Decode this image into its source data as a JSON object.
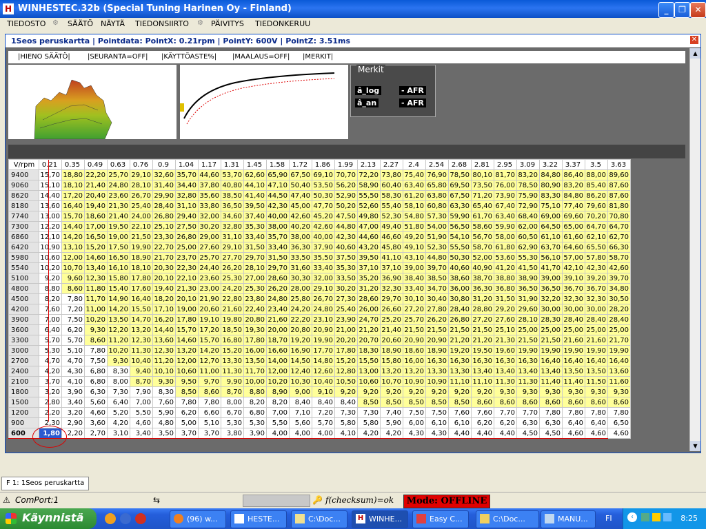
{
  "window": {
    "title": "WINHESTEC.32b (Special Tuning Harinen Oy - Finland)"
  },
  "menu": [
    "TIEDOSTO",
    "SÄÄTÖ",
    "NÄYTÄ",
    "TIEDONSIIRTO",
    "PÄIVITYS",
    "TIEDONKERUU"
  ],
  "child": {
    "title": "1Seos peruskartta | Pointdata: PointX: 0.21rpm | PointY: 600V | PointZ: 3.51ms",
    "toolbar": [
      "|HIENO SÄÄTÖ|",
      "|SEURANTA=OFF|",
      "|KÄYTTÖASTE%|",
      "|MAALAUS=OFF|",
      "|MERKIT|"
    ],
    "merkit": {
      "title": "Merkit",
      "tags": [
        [
          "â_log",
          "- AFR"
        ],
        [
          "â_an",
          "- AFR"
        ]
      ]
    }
  },
  "grid": {
    "corner": "V/rpm",
    "cols": [
      "0.21",
      "0.35",
      "0.49",
      "0.63",
      "0.76",
      "0.9",
      "1.04",
      "1.17",
      "1.31",
      "1.45",
      "1.58",
      "1.72",
      "1.86",
      "1.99",
      "2.13",
      "2.27",
      "2.4",
      "2.54",
      "2.68",
      "2.81",
      "2.95",
      "3.09",
      "3.22",
      "3.37",
      "3.5",
      "3.63"
    ],
    "rows": [
      [
        "9400",
        [
          "15,70",
          "18,80",
          "22,20",
          "25,70",
          "29,10",
          "32,60",
          "35,70",
          "44,60",
          "53,70",
          "62,60",
          "65,90",
          "67,50",
          "69,10",
          "70,70",
          "72,20",
          "73,80",
          "75,40",
          "76,90",
          "78,50",
          "80,10",
          "81,70",
          "83,20",
          "84,80",
          "86,40",
          "88,00",
          "89,60"
        ]
      ],
      [
        "9060",
        [
          "15,10",
          "18,10",
          "21,40",
          "24,80",
          "28,10",
          "31,40",
          "34,40",
          "37,80",
          "40,80",
          "44,10",
          "47,10",
          "50,40",
          "53,50",
          "56,20",
          "58,90",
          "60,40",
          "63,40",
          "65,80",
          "69,50",
          "73,50",
          "76,00",
          "78,50",
          "80,90",
          "83,20",
          "85,40",
          "87,60"
        ]
      ],
      [
        "8620",
        [
          "14,40",
          "17,20",
          "20,40",
          "23,60",
          "26,70",
          "29,90",
          "32,80",
          "35,60",
          "38,50",
          "41,40",
          "44,50",
          "47,40",
          "50,30",
          "52,90",
          "55,50",
          "58,30",
          "61,20",
          "63,80",
          "67,50",
          "71,20",
          "73,90",
          "75,90",
          "83,30",
          "84,80",
          "86,20",
          "87,60"
        ]
      ],
      [
        "8180",
        [
          "13,60",
          "16,40",
          "19,40",
          "21,30",
          "25,40",
          "28,40",
          "31,10",
          "33,80",
          "36,50",
          "39,50",
          "42,30",
          "45,00",
          "47,70",
          "50,20",
          "52,60",
          "55,40",
          "58,10",
          "60,80",
          "63,30",
          "65,40",
          "67,40",
          "72,90",
          "75,10",
          "77,40",
          "79,60",
          "81,80"
        ]
      ],
      [
        "7740",
        [
          "13,00",
          "15,70",
          "18,60",
          "21,40",
          "24,00",
          "26,80",
          "29,40",
          "32,00",
          "34,60",
          "37,40",
          "40,00",
          "42,60",
          "45,20",
          "47,50",
          "49,80",
          "52,30",
          "54,80",
          "57,30",
          "59,90",
          "61,70",
          "63,40",
          "68,40",
          "69,00",
          "69,60",
          "70,20",
          "70,80"
        ]
      ],
      [
        "7300",
        [
          "12,20",
          "14,40",
          "17,00",
          "19,50",
          "22,10",
          "25,10",
          "27,50",
          "30,20",
          "32,80",
          "35,30",
          "38,00",
          "40,20",
          "42,60",
          "44,80",
          "47,00",
          "49,40",
          "51,80",
          "54,00",
          "56,50",
          "58,60",
          "59,90",
          "62,00",
          "64,50",
          "65,00",
          "64,70",
          "64,70"
        ]
      ],
      [
        "6860",
        [
          "12,10",
          "14,20",
          "16,50",
          "19,00",
          "21,50",
          "23,30",
          "26,80",
          "29,00",
          "31,10",
          "33,40",
          "35,70",
          "38,00",
          "40,00",
          "42,30",
          "44,60",
          "46,60",
          "49,20",
          "51,90",
          "54,10",
          "56,70",
          "58,00",
          "60,50",
          "61,10",
          "61,60",
          "62,10",
          "62,70"
        ]
      ],
      [
        "6420",
        [
          "10,90",
          "13,10",
          "15,20",
          "17,50",
          "19,90",
          "22,70",
          "25,00",
          "27,60",
          "29,10",
          "31,50",
          "33,40",
          "36,30",
          "37,90",
          "40,60",
          "43,20",
          "45,80",
          "49,10",
          "52,30",
          "55,50",
          "58,70",
          "61,80",
          "62,90",
          "63,70",
          "64,60",
          "65,50",
          "66,30"
        ]
      ],
      [
        "5980",
        [
          "10,60",
          "12,00",
          "14,60",
          "16,50",
          "18,90",
          "21,70",
          "23,70",
          "25,70",
          "27,70",
          "29,70",
          "31,50",
          "33,50",
          "35,50",
          "37,50",
          "39,50",
          "41,10",
          "43,10",
          "44,80",
          "50,30",
          "52,00",
          "53,60",
          "55,30",
          "56,10",
          "57,00",
          "57,80",
          "58,70"
        ]
      ],
      [
        "5540",
        [
          "10,20",
          "10,70",
          "13,40",
          "16,10",
          "18,10",
          "20,30",
          "22,30",
          "24,40",
          "26,20",
          "28,10",
          "29,70",
          "31,60",
          "33,40",
          "35,30",
          "37,10",
          "37,10",
          "39,00",
          "39,70",
          "40,60",
          "40,90",
          "41,20",
          "41,50",
          "41,70",
          "42,10",
          "42,30",
          "42,60"
        ]
      ],
      [
        "5100",
        [
          "9,20",
          "9,60",
          "12,30",
          "15,80",
          "17,80",
          "20,10",
          "22,10",
          "23,60",
          "25,30",
          "27,00",
          "28,60",
          "30,30",
          "32,00",
          "33,50",
          "35,20",
          "36,90",
          "38,40",
          "38,50",
          "38,60",
          "38,70",
          "38,80",
          "38,90",
          "39,00",
          "39,10",
          "39,20",
          "39,70"
        ]
      ],
      [
        "4800",
        [
          "8,80",
          "8,60",
          "11,80",
          "15,40",
          "17,60",
          "19,40",
          "21,30",
          "23,00",
          "24,20",
          "25,30",
          "26,20",
          "28,00",
          "29,10",
          "30,20",
          "31,20",
          "32,30",
          "33,40",
          "34,70",
          "36,00",
          "36,30",
          "36,80",
          "36,50",
          "36,50",
          "36,70",
          "36,70",
          "34,80"
        ]
      ],
      [
        "4500",
        [
          "8,20",
          "7,80",
          "11,70",
          "14,90",
          "16,40",
          "18,20",
          "20,10",
          "21,90",
          "22,80",
          "23,80",
          "24,80",
          "25,80",
          "26,70",
          "27,30",
          "28,60",
          "29,70",
          "30,10",
          "30,40",
          "30,80",
          "31,20",
          "31,50",
          "31,90",
          "32,20",
          "32,30",
          "32,30",
          "30,50"
        ]
      ],
      [
        "4200",
        [
          "7,60",
          "7,20",
          "11,00",
          "14,20",
          "15,50",
          "17,10",
          "19,00",
          "20,60",
          "21,60",
          "22,40",
          "23,40",
          "24,20",
          "24,80",
          "25,40",
          "26,00",
          "26,60",
          "27,20",
          "27,80",
          "28,40",
          "28,80",
          "29,20",
          "29,60",
          "30,00",
          "30,00",
          "30,00",
          "28,20"
        ]
      ],
      [
        "3900",
        [
          "7,00",
          "7,50",
          "10,20",
          "13,50",
          "14,70",
          "16,20",
          "17,80",
          "19,10",
          "19,80",
          "20,80",
          "21,60",
          "22,20",
          "23,10",
          "23,90",
          "24,70",
          "25,20",
          "25,70",
          "26,20",
          "26,80",
          "27,20",
          "27,60",
          "28,10",
          "28,30",
          "28,40",
          "28,40",
          "28,40"
        ]
      ],
      [
        "3600",
        [
          "6,40",
          "6,20",
          "9,30",
          "12,20",
          "13,20",
          "14,40",
          "15,70",
          "17,20",
          "18,50",
          "19,30",
          "20,00",
          "20,80",
          "20,90",
          "21,00",
          "21,20",
          "21,40",
          "21,50",
          "21,50",
          "21,50",
          "21,50",
          "25,10",
          "25,00",
          "25,00",
          "25,00",
          "25,00",
          "25,00"
        ]
      ],
      [
        "3300",
        [
          "5,70",
          "5,70",
          "8,60",
          "11,20",
          "12,30",
          "13,60",
          "14,60",
          "15,70",
          "16,80",
          "17,80",
          "18,70",
          "19,20",
          "19,90",
          "20,20",
          "20,70",
          "20,60",
          "20,90",
          "20,90",
          "21,20",
          "21,20",
          "21,30",
          "21,50",
          "21,50",
          "21,60",
          "21,60",
          "21,70"
        ]
      ],
      [
        "3000",
        [
          "5,30",
          "5,10",
          "7,80",
          "10,20",
          "11,30",
          "12,30",
          "13,20",
          "14,20",
          "15,20",
          "16,00",
          "16,60",
          "16,90",
          "17,70",
          "17,80",
          "18,30",
          "18,90",
          "18,60",
          "18,90",
          "19,20",
          "19,50",
          "19,60",
          "19,90",
          "19,90",
          "19,90",
          "19,90",
          "19,90"
        ]
      ],
      [
        "2700",
        [
          "4,70",
          "4,70",
          "7,50",
          "9,30",
          "10,40",
          "11,20",
          "12,00",
          "12,70",
          "13,30",
          "13,50",
          "14,00",
          "14,50",
          "14,80",
          "15,20",
          "15,50",
          "15,80",
          "16,00",
          "16,30",
          "16,30",
          "16,30",
          "16,30",
          "16,30",
          "16,40",
          "16,40",
          "16,40",
          "16,40"
        ]
      ],
      [
        "2400",
        [
          "4,20",
          "4,30",
          "6,80",
          "8,30",
          "9,40",
          "10,10",
          "10,60",
          "11,00",
          "11,30",
          "11,70",
          "12,00",
          "12,40",
          "12,60",
          "12,80",
          "13,00",
          "13,20",
          "13,20",
          "13,30",
          "13,30",
          "13,40",
          "13,40",
          "13,40",
          "13,40",
          "13,50",
          "13,50",
          "13,60"
        ]
      ],
      [
        "2100",
        [
          "3,70",
          "4,10",
          "6,80",
          "8,00",
          "8,70",
          "9,30",
          "9,50",
          "9,70",
          "9,90",
          "10,00",
          "10,20",
          "10,30",
          "10,40",
          "10,50",
          "10,60",
          "10,70",
          "10,90",
          "10,90",
          "11,10",
          "11,10",
          "11,30",
          "11,30",
          "11,40",
          "11,40",
          "11,50",
          "11,60"
        ]
      ],
      [
        "1800",
        [
          "3,20",
          "3,90",
          "6,30",
          "7,30",
          "7,90",
          "8,30",
          "8,50",
          "8,60",
          "8,70",
          "8,80",
          "8,90",
          "9,00",
          "9,10",
          "9,20",
          "9,20",
          "9,20",
          "9,20",
          "9,20",
          "9,20",
          "9,20",
          "9,30",
          "9,30",
          "9,30",
          "9,30",
          "9,30",
          "9,30"
        ]
      ],
      [
        "1500",
        [
          "2,80",
          "3,40",
          "5,60",
          "6,40",
          "7,00",
          "7,60",
          "7,80",
          "7,80",
          "8,00",
          "8,20",
          "8,20",
          "8,40",
          "8,40",
          "8,40",
          "8,50",
          "8,50",
          "8,50",
          "8,50",
          "8,50",
          "8,60",
          "8,60",
          "8,60",
          "8,60",
          "8,60",
          "8,60",
          "8,60"
        ]
      ],
      [
        "1200",
        [
          "2,20",
          "3,20",
          "4,60",
          "5,20",
          "5,50",
          "5,90",
          "6,20",
          "6,60",
          "6,70",
          "6,80",
          "7,00",
          "7,10",
          "7,20",
          "7,30",
          "7,30",
          "7,40",
          "7,50",
          "7,50",
          "7,60",
          "7,60",
          "7,70",
          "7,70",
          "7,80",
          "7,80",
          "7,80",
          "7,80"
        ]
      ],
      [
        "900",
        [
          "2,30",
          "2,90",
          "3,60",
          "4,20",
          "4,60",
          "4,80",
          "5,00",
          "5,10",
          "5,30",
          "5,30",
          "5,50",
          "5,60",
          "5,70",
          "5,80",
          "5,80",
          "5,90",
          "6,00",
          "6,10",
          "6,10",
          "6,20",
          "6,20",
          "6,30",
          "6,30",
          "6,40",
          "6,40",
          "6,50"
        ]
      ],
      [
        "600",
        [
          "1,80",
          "2,20",
          "2,70",
          "3,10",
          "3,40",
          "3,50",
          "3,70",
          "3,70",
          "3,80",
          "3,90",
          "4,00",
          "4,00",
          "4,00",
          "4,10",
          "4,20",
          "4,20",
          "4,30",
          "4,30",
          "4,40",
          "4,40",
          "4,40",
          "4,50",
          "4,50",
          "4,60",
          "4,60",
          "4,60"
        ]
      ]
    ]
  },
  "tabbar": {
    "tab": "F 1:  1Seos peruskartta"
  },
  "status": {
    "comport": "ComPort:1",
    "checksum": "f(checksum)=ok",
    "mode": "Mode: OFFLINE"
  },
  "taskbar": {
    "start": "Käynnistä",
    "buttons": [
      "(96) w...",
      "HESTE...",
      "C:\\Doc...",
      "WINHE...",
      "Easy C...",
      "C:\\Doc...",
      "MANU..."
    ],
    "lang": "FI",
    "clock": "8:25"
  }
}
